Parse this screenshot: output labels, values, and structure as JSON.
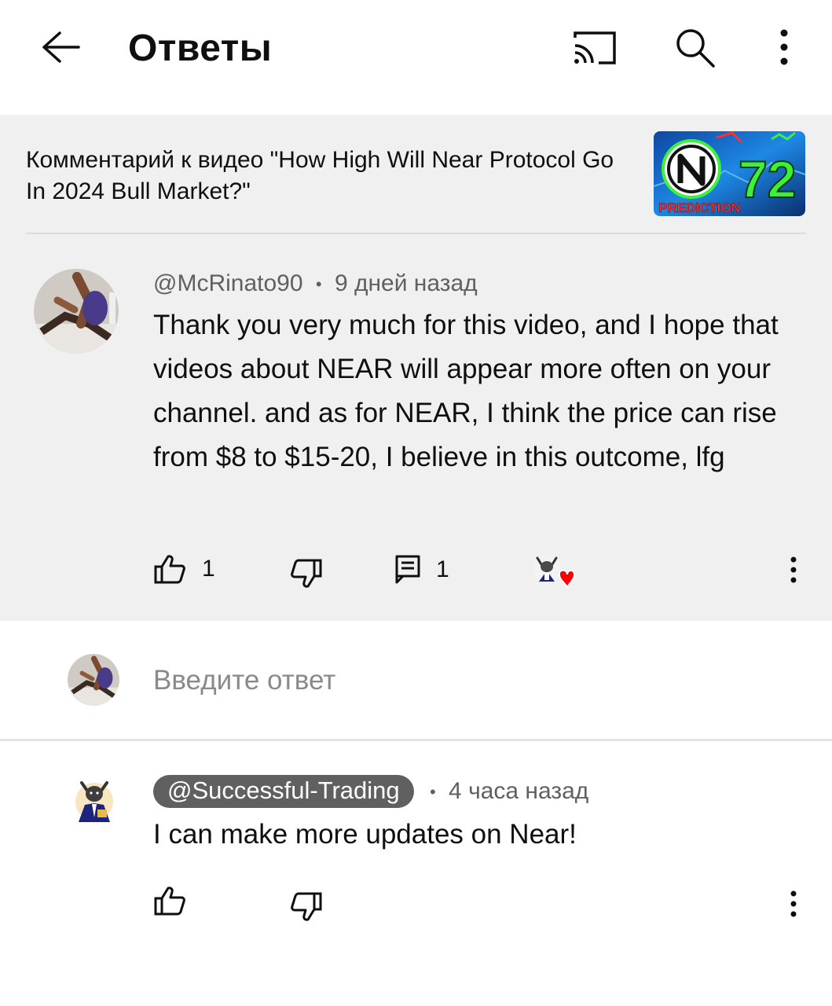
{
  "header": {
    "title": "Ответы",
    "back_icon": "arrow-left-icon",
    "cast_icon": "cast-icon",
    "search_icon": "search-icon",
    "more_icon": "more-vert-icon"
  },
  "video_ref": {
    "text": "Комментарий к видео \"How High Will Near Protocol Go In 2024 Bull Market?\"",
    "thumbnail": {
      "number": "72",
      "caption": "PREDICTION"
    }
  },
  "parent_comment": {
    "author": "@McRinato90",
    "separator": "•",
    "time": "9 дней назад",
    "text": "Thank you very much for this video, and I hope that videos about NEAR will appear more often on your channel.  and as for NEAR, I think the price can rise from $8 to $15-20, I believe in this outcome, lfg",
    "likes": "1",
    "replies": "1"
  },
  "reply_input": {
    "placeholder": "Введите ответ"
  },
  "reply": {
    "author": "@Successful-Trading",
    "separator": "•",
    "time": "4 часа назад",
    "text": "I can make more updates on Near!"
  },
  "colors": {
    "thread_bg": "#f0f0f0",
    "meta_text": "#606060",
    "heart": "#ff0000",
    "thumb_bg": "#1565c0",
    "thumb_number": "#3cf03c"
  }
}
